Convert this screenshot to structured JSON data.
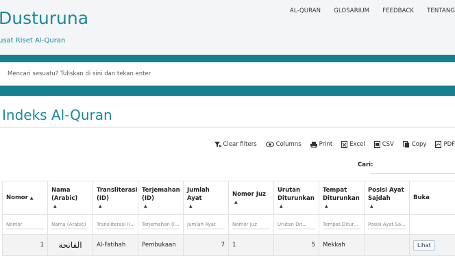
{
  "header": {
    "title": "Dusturuna",
    "subtitle": "usat Riset Al-Quran",
    "nav": [
      "AL-QURAN",
      "GLOSARIUM",
      "FEEDBACK",
      "TENTANG"
    ]
  },
  "search": {
    "placeholder": "Mencari sesuatu? Tuliskan di sini dan tekan enter"
  },
  "page": {
    "title": "Indeks Al-Quran"
  },
  "toolbar": {
    "clear_filters": "Clear filters",
    "columns": "Columns",
    "print": "Print",
    "excel": "Excel",
    "csv": "CSV",
    "copy": "Copy",
    "pdf": "PDF"
  },
  "table_search": {
    "label": "Cari:"
  },
  "table": {
    "headers": [
      "Nomor",
      "Nama (Arabic)",
      "Transliterasi (ID)",
      "Terjemahan (ID)",
      "Jumlah Ayat",
      "Nomor Juz",
      "Urutan Diturunkan",
      "Tempat Diturunkan",
      "Posisi Ayat Sajdah",
      "Buka"
    ],
    "filters": [
      "Nomor",
      "Nama (Arabic)",
      "Transliterasi (I...",
      "Terjemahan (I...",
      "Jumlah Ayat",
      "Nomor Juz",
      "Urutan Dit...",
      "Tempat Ditur...",
      "Posisi Ayat Sa..."
    ],
    "rows": [
      {
        "nomor": "1",
        "arabic": "الفاتحة",
        "transliterasi": "Al-Fatihah",
        "terjemahan": "Pembukaan",
        "jumlah_ayat": "7",
        "juz": "1",
        "urutan": "5",
        "tempat": "Mekkah",
        "sajdah": "",
        "buka": "Lihat"
      }
    ]
  },
  "colors": {
    "accent": "#1a8a9a",
    "band": "#177f8f"
  }
}
